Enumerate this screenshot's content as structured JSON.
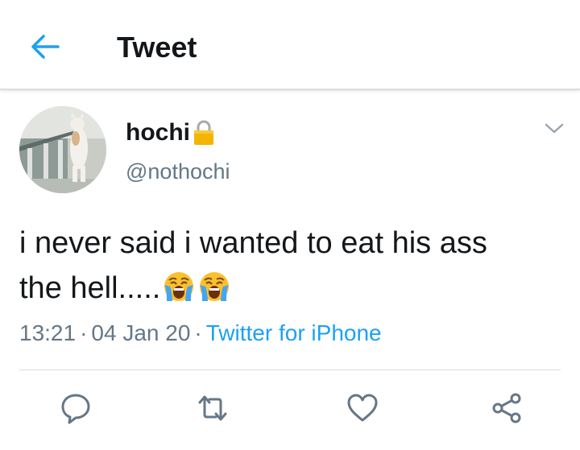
{
  "header": {
    "title": "Tweet",
    "back_icon": "arrow-left-icon"
  },
  "tweet": {
    "author_name": "hochi",
    "author_handle": "@nothochi",
    "protected_icon": "lock-icon",
    "text_line1": "i never said i wanted to eat his ass",
    "text_line2": "the hell.....",
    "emojis": [
      "loudly-crying-face",
      "loudly-crying-face"
    ],
    "time": "13:21",
    "date": "04 Jan 20",
    "separator": "·",
    "source": "Twitter for iPhone"
  },
  "actions": [
    "reply-icon",
    "retweet-icon",
    "like-icon",
    "share-icon"
  ],
  "colors": {
    "accent": "#1da1f2",
    "secondary_text": "#657786",
    "icon": "#657786",
    "lock": "#f4b400"
  }
}
